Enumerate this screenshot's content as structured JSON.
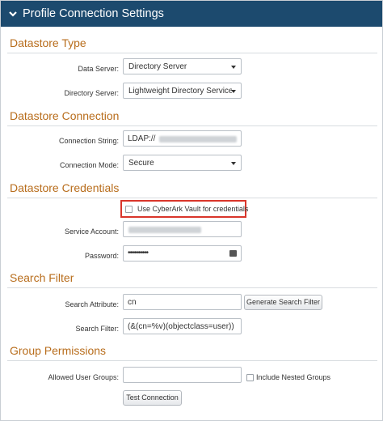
{
  "header": {
    "title": "Profile Connection Settings",
    "icon": "chevron-down-icon"
  },
  "datastore_type": {
    "heading": "Datastore Type",
    "data_server": {
      "label": "Data Server:",
      "value": "Directory Server"
    },
    "directory_server": {
      "label": "Directory Server:",
      "value": "Lightweight Directory Service"
    }
  },
  "datastore_connection": {
    "heading": "Datastore Connection",
    "connection_string": {
      "label": "Connection String:",
      "value": "LDAP://"
    },
    "connection_mode": {
      "label": "Connection Mode:",
      "value": "Secure"
    }
  },
  "datastore_credentials": {
    "heading": "Datastore Credentials",
    "cyberark": {
      "label": "Use CyberArk Vault for credentials",
      "checked": false
    },
    "service_account": {
      "label": "Service Account:",
      "value": ""
    },
    "password": {
      "label": "Password:",
      "value": "••••••••••"
    }
  },
  "search_filter": {
    "heading": "Search Filter",
    "search_attribute": {
      "label": "Search Attribute:",
      "value": "cn"
    },
    "generate_button": "Generate Search Filter",
    "filter": {
      "label": "Search Filter:",
      "value": "(&(cn=%v)(objectclass=user))"
    }
  },
  "group_permissions": {
    "heading": "Group Permissions",
    "allowed_groups": {
      "label": "Allowed User Groups:",
      "value": ""
    },
    "nested": {
      "label": "Include Nested Groups",
      "checked": false
    },
    "test_button": "Test Connection"
  },
  "colors": {
    "header_bg": "#1c4a6e",
    "heading": "#b86d1c",
    "highlight": "#d9362b"
  }
}
